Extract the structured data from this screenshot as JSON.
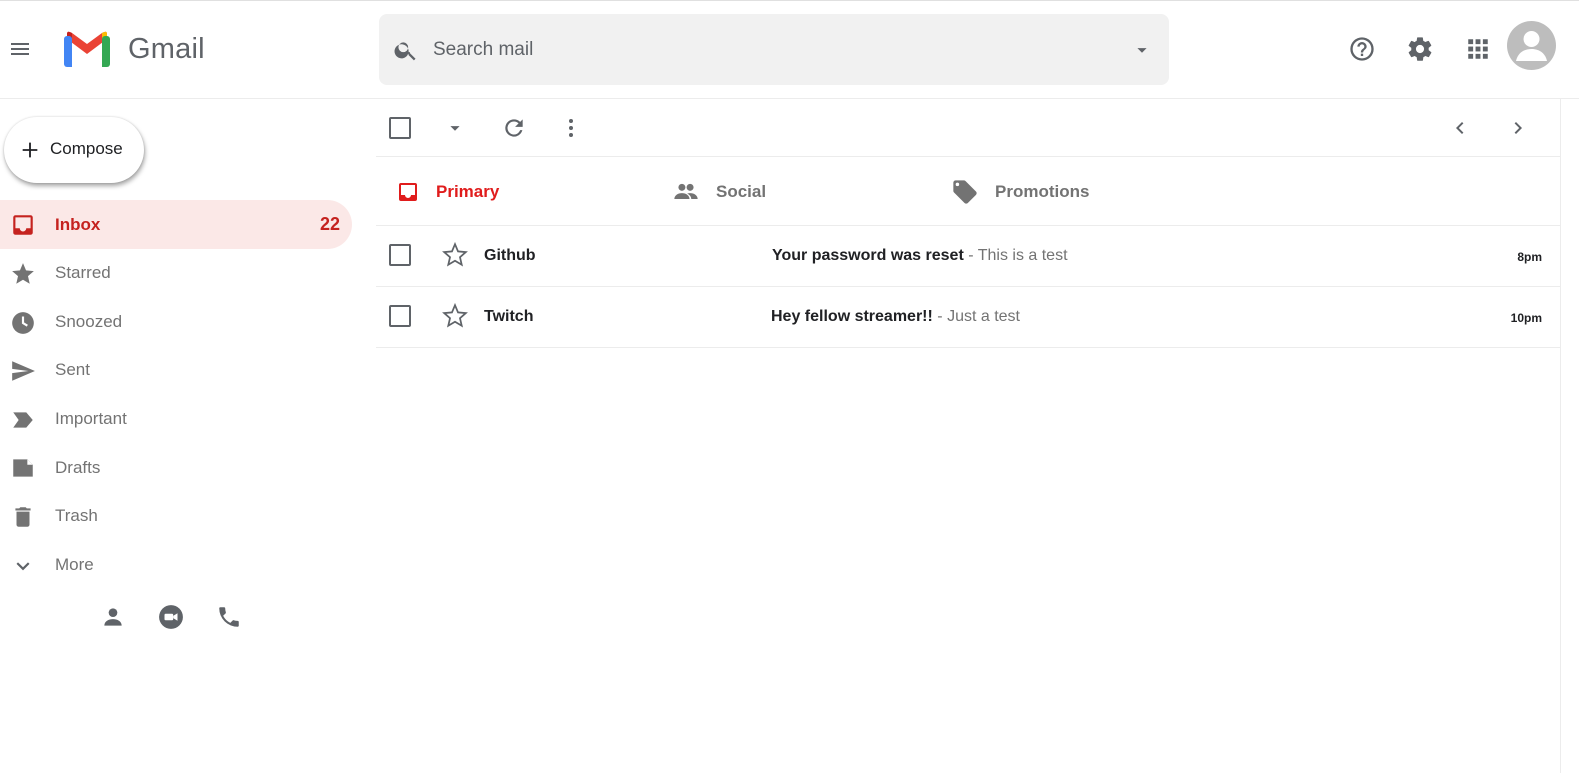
{
  "app": {
    "logo_text": "Gmail"
  },
  "search": {
    "placeholder": "Search mail"
  },
  "sidebar": {
    "compose_label": "Compose",
    "items": [
      {
        "label": "Inbox",
        "count": "22",
        "icon": "inbox-icon"
      },
      {
        "label": "Starred",
        "icon": "star-icon"
      },
      {
        "label": "Snoozed",
        "icon": "clock-icon"
      },
      {
        "label": "Sent",
        "icon": "send-icon"
      },
      {
        "label": "Important",
        "icon": "important-icon"
      },
      {
        "label": "Drafts",
        "icon": "draft-icon"
      },
      {
        "label": "Trash",
        "icon": "trash-icon"
      },
      {
        "label": "More",
        "icon": "chevron-down-icon"
      }
    ]
  },
  "tabs": [
    {
      "label": "Primary",
      "icon": "inbox-icon"
    },
    {
      "label": "Social",
      "icon": "people-icon"
    },
    {
      "label": "Promotions",
      "icon": "tag-icon"
    }
  ],
  "messages": [
    {
      "sender": "Github",
      "subject": "Your password was reset",
      "snippet": " - This is a test",
      "time": "8pm"
    },
    {
      "sender": "Twitch",
      "subject": "Hey fellow streamer!!",
      "snippet": " - Just a test",
      "time": "10pm"
    }
  ],
  "colors": {
    "accent_red": "#c5221f",
    "primary_tab_red": "#e01c1c",
    "active_bg": "#fbe8e7",
    "icon_gray": "#5f6368"
  }
}
